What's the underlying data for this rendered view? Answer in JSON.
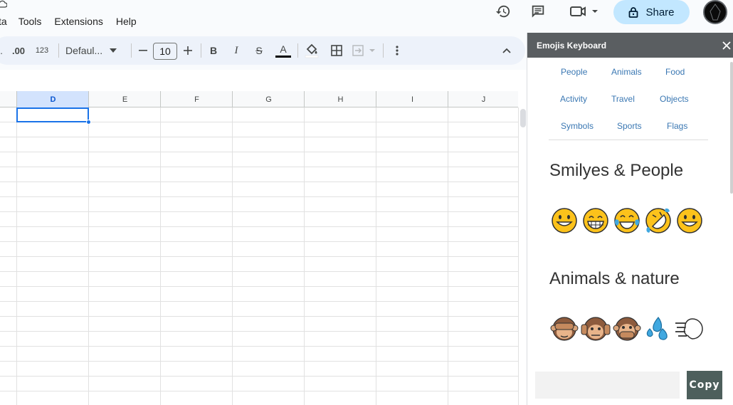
{
  "menu": {
    "items": [
      "ta",
      "Tools",
      "Extensions",
      "Help"
    ]
  },
  "header": {
    "share_label": "Share"
  },
  "toolbar": {
    "decimal_decrease": ".",
    "decimal_increase": ".00",
    "format_number": "123",
    "font_name": "Defaul...",
    "font_size": "10",
    "bold": "B",
    "italic": "I",
    "strike": "S",
    "text_color": "A"
  },
  "grid": {
    "columns": [
      "D",
      "E",
      "F",
      "G",
      "H",
      "I",
      "J"
    ],
    "selected_column": "D"
  },
  "panel": {
    "title": "Emojis Keyboard",
    "categories": [
      "People",
      "Animals",
      "Food",
      "Activity",
      "Travel",
      "Objects",
      "Symbols",
      "Sports",
      "Flags"
    ],
    "sections": [
      {
        "title": "Smilyes & People"
      },
      {
        "title": "Animals & nature"
      }
    ],
    "copy_placeholder": "",
    "copy_label": "Copy"
  },
  "colors": {
    "accent": "#1a73e8",
    "share_bg": "#c2e7ff",
    "panel_header": "#5a5e61",
    "category_link": "#3b78b3",
    "copy_button": "#4d5f5c"
  }
}
